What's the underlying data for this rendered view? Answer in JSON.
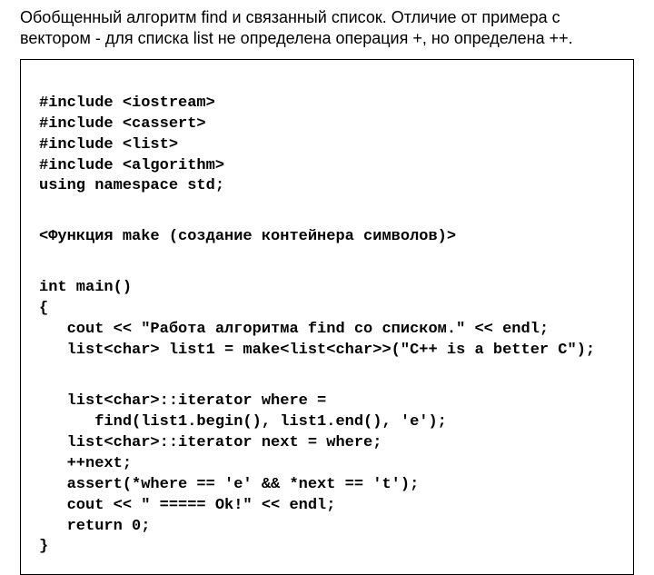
{
  "caption": "Обобщенный алгоритм find и связанный список. Отличие от примера с вектором - для списка list не определена операция +, но определена ++.",
  "code": {
    "l01": "#include <iostream>",
    "l02": "#include <cassert>",
    "l03": "#include <list>",
    "l04": "#include <algorithm>",
    "l05": "using namespace std;",
    "l06": "<Функция make (создание контейнера символов)>",
    "l07": "int main()",
    "l08": "{",
    "l09": "   cout << \"Работа алгоритма find со списком.\" << endl;",
    "l10": "   list<char> list1 = make<list<char>>(\"C++ is a better C\");",
    "l11": "   list<char>::iterator where =",
    "l12": "      find(list1.begin(), list1.end(), 'e');",
    "l13": "   list<char>::iterator next = where;",
    "l14": "   ++next;",
    "l15": "   assert(*where == 'e' && *next == 't');",
    "l16": "   cout << \" ===== Ok!\" << endl;",
    "l17": "   return 0;",
    "l18": "}"
  }
}
